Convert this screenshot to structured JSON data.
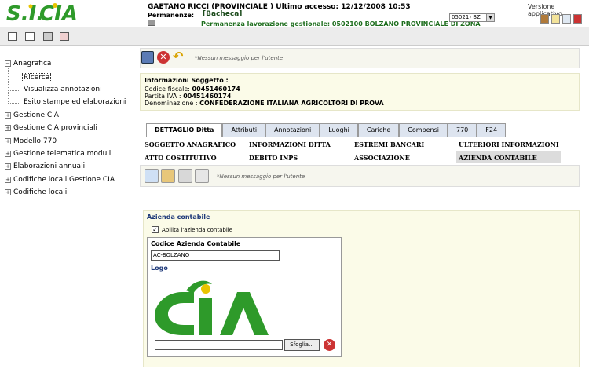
{
  "header": {
    "logo_text": "S.I.CIA",
    "user_line": "GAETANO RICCI (PROVINCIALE ) Ultimo accesso: 12/12/2008 10:53",
    "permanenze_label": "Permanenze:",
    "bacheca": "[Bacheca]",
    "permanenza_lavorazione": "Permanenza lavorazione gestionale: 0502100 BOLZANO PROVINCIALE DI ZONA",
    "versione": "Versione applicativo",
    "sede_select": "05021) BZ"
  },
  "sidebar": {
    "items": [
      {
        "label": "Anagrafica",
        "expanded": true
      },
      {
        "label": "Gestione CIA"
      },
      {
        "label": "Gestione CIA provinciali"
      },
      {
        "label": "Modello 770"
      },
      {
        "label": "Gestione telematica moduli"
      },
      {
        "label": "Elaborazioni annuali"
      },
      {
        "label": "Codifiche locali Gestione CIA"
      },
      {
        "label": "Codifiche locali"
      }
    ],
    "anagrafica_children": [
      "Ricerca",
      "Visualizza annotazioni",
      "Esito stampe ed elaborazioni"
    ]
  },
  "toolbar": {
    "message": "*Nessun messaggio per l'utente"
  },
  "soggetto": {
    "title": "Informazioni Soggetto :",
    "codice_fiscale_label": "Codice fiscale:",
    "codice_fiscale": "00451460174",
    "partita_iva_label": "Partita IVA :",
    "partita_iva": "00451460174",
    "denominazione_label": "Denominazione :",
    "denominazione": "CONFEDERAZIONE ITALIANA AGRICOLTORI DI PROVA"
  },
  "tabs": [
    "DETTAGLIO Ditta",
    "Attributi",
    "Annotazioni",
    "Luoghi",
    "Cariche",
    "Compensi",
    "770",
    "F24"
  ],
  "sections": {
    "row1": [
      "SOGGETTO ANAGRAFICO",
      "INFORMAZIONI DITTA",
      "ESTREMI BANCARI",
      "ULTERIORI INFORMAZIONI"
    ],
    "row2": [
      "ATTO COSTITUTIVO",
      "DEBITO INPS",
      "ASSOCIAZIONE",
      "AZIENDA CONTABILE"
    ]
  },
  "section_toolbar": {
    "message": "*Nessun messaggio per l'utente"
  },
  "azienda": {
    "title": "Azienda contabile",
    "checkbox_label": "Abilita l'azienda contabile",
    "checked": true,
    "codice_label": "Codice Azienda Contabile",
    "codice_value": "AC-BOLZANO",
    "logo_label": "Logo",
    "logo_text": "CIA",
    "sfoglia": "Sfoglia..."
  },
  "colors": {
    "brand_green": "#2e9a2a",
    "accent_yellow": "#e8c400"
  }
}
